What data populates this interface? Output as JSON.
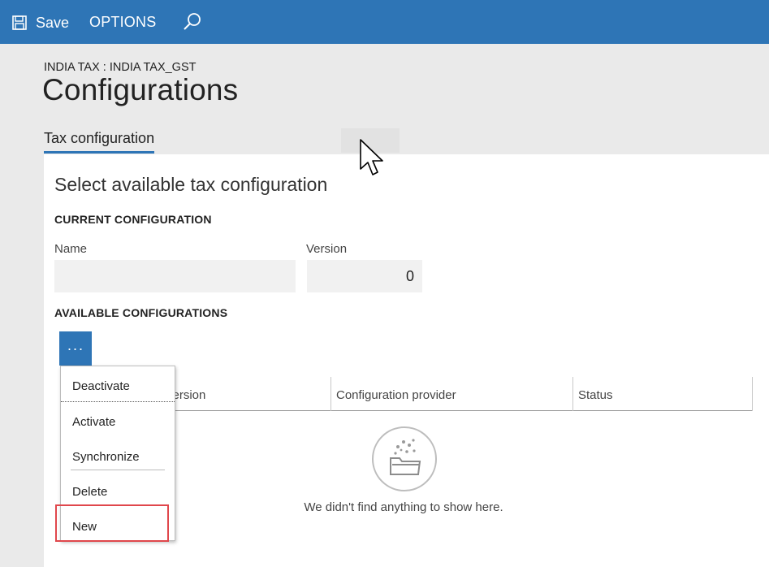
{
  "toolbar": {
    "save_label": "Save",
    "options_label": "OPTIONS",
    "icons": {
      "save": "save-icon",
      "search": "search-icon"
    }
  },
  "header": {
    "caption": "INDIA TAX : INDIA TAX_GST",
    "title": "Configurations"
  },
  "tabs": [
    {
      "label": "Tax configuration",
      "selected": true
    }
  ],
  "panel": {
    "title": "Select available tax configuration",
    "current": {
      "group_label": "CURRENT CONFIGURATION",
      "name_label": "Name",
      "name_value": "",
      "version_label": "Version",
      "version_value": "0"
    },
    "available": {
      "group_label": "AVAILABLE CONFIGURATIONS",
      "more_label": "···",
      "columns": [
        "version",
        "Configuration provider",
        "Status"
      ],
      "empty_text": "We didn't find anything to show here."
    }
  },
  "menu": {
    "items": [
      "Deactivate",
      "Activate",
      "Synchronize",
      "Delete",
      "New"
    ],
    "highlighted": "New"
  },
  "colors": {
    "accent": "#2e75b6",
    "highlight": "#e0474c",
    "background": "#eaeaea"
  }
}
